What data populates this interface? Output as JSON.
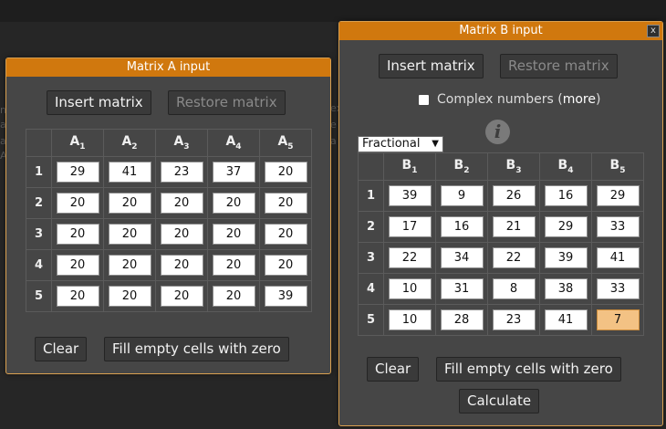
{
  "background_text": {
    "left": [
      "n",
      "a",
      "a",
      "A"
    ],
    "right": [
      "ex",
      "e",
      "a"
    ]
  },
  "matrixA": {
    "title": "Matrix A input",
    "insert_label": "Insert matrix",
    "restore_label": "Restore matrix",
    "col_prefix": "A",
    "col_indices": [
      "1",
      "2",
      "3",
      "4",
      "5"
    ],
    "row_labels": [
      "1",
      "2",
      "3",
      "4",
      "5"
    ],
    "rows": [
      [
        "29",
        "41",
        "23",
        "37",
        "20"
      ],
      [
        "20",
        "20",
        "20",
        "20",
        "20"
      ],
      [
        "20",
        "20",
        "20",
        "20",
        "20"
      ],
      [
        "20",
        "20",
        "20",
        "20",
        "20"
      ],
      [
        "20",
        "20",
        "20",
        "20",
        "39"
      ]
    ],
    "clear_label": "Clear",
    "fill_label": "Fill empty cells with zero"
  },
  "matrixB": {
    "title": "Matrix B input",
    "close_label": "x",
    "insert_label": "Insert matrix",
    "restore_label": "Restore matrix",
    "complex_label": "Complex numbers (",
    "complex_more": "more",
    "complex_end": ")",
    "complex_checked": false,
    "format_selected": "Fractional",
    "info_glyph": "i",
    "col_prefix": "B",
    "col_indices": [
      "1",
      "2",
      "3",
      "4",
      "5"
    ],
    "row_labels": [
      "1",
      "2",
      "3",
      "4",
      "5"
    ],
    "rows": [
      [
        "39",
        "9",
        "26",
        "16",
        "29"
      ],
      [
        "17",
        "16",
        "21",
        "29",
        "33"
      ],
      [
        "22",
        "34",
        "22",
        "39",
        "41"
      ],
      [
        "10",
        "31",
        "8",
        "38",
        "33"
      ],
      [
        "10",
        "28",
        "23",
        "41",
        "7"
      ]
    ],
    "focused_cell": "B5,5",
    "clear_label": "Clear",
    "fill_label": "Fill empty cells with zero",
    "calculate_label": "Calculate"
  },
  "colors": {
    "titlebar": "#d0780e",
    "dialog_bg": "#464646",
    "focused_cell": "#f3c284"
  }
}
